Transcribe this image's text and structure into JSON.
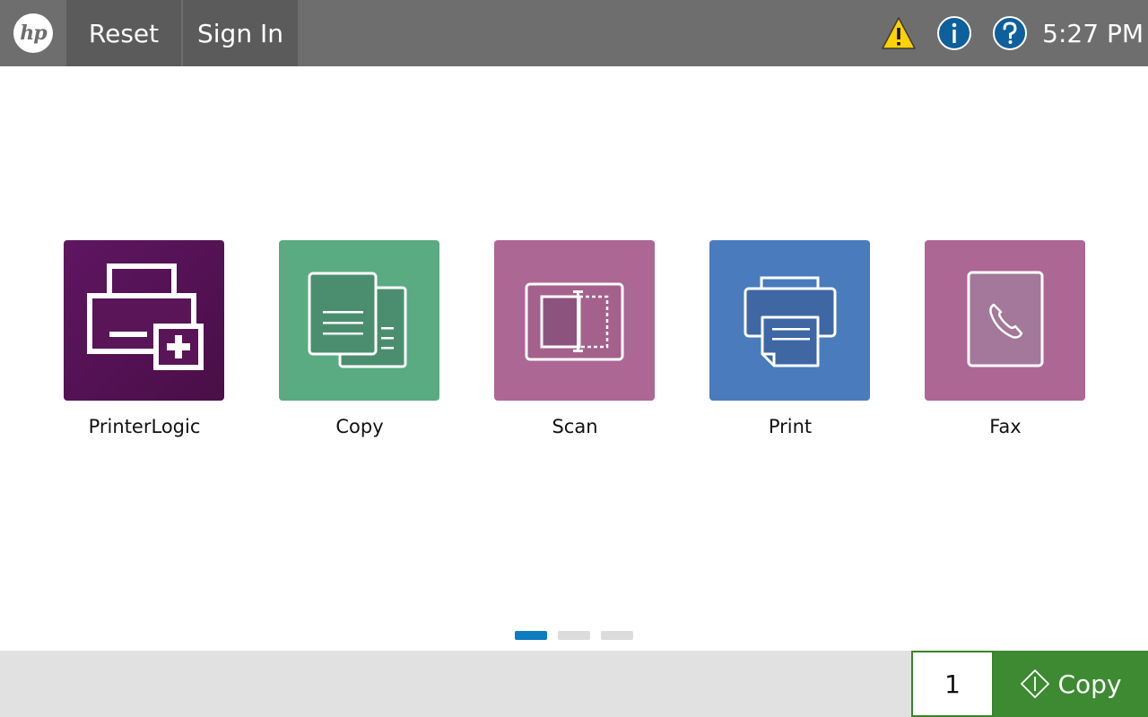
{
  "header": {
    "logo_text": "hp",
    "reset_label": "Reset",
    "signin_label": "Sign In",
    "status_icons": [
      "warning-icon",
      "info-icon",
      "help-icon"
    ],
    "time": "5:27 PM"
  },
  "apps": [
    {
      "label": "PrinterLogic",
      "icon": "printerlogic-icon",
      "color": "#55124f"
    },
    {
      "label": "Copy",
      "icon": "copy-icon",
      "color": "#5aaa82"
    },
    {
      "label": "Scan",
      "icon": "scan-icon",
      "color": "#ac6795"
    },
    {
      "label": "Print",
      "icon": "print-icon",
      "color": "#4a7bbc"
    },
    {
      "label": "Fax",
      "icon": "fax-icon",
      "color": "#ac6795"
    }
  ],
  "pager": {
    "pages": 3,
    "current": 1,
    "active_color": "#0f7bc0"
  },
  "footer": {
    "copies_value": "1",
    "start_label": "Copy",
    "start_color": "#3e8a32"
  }
}
